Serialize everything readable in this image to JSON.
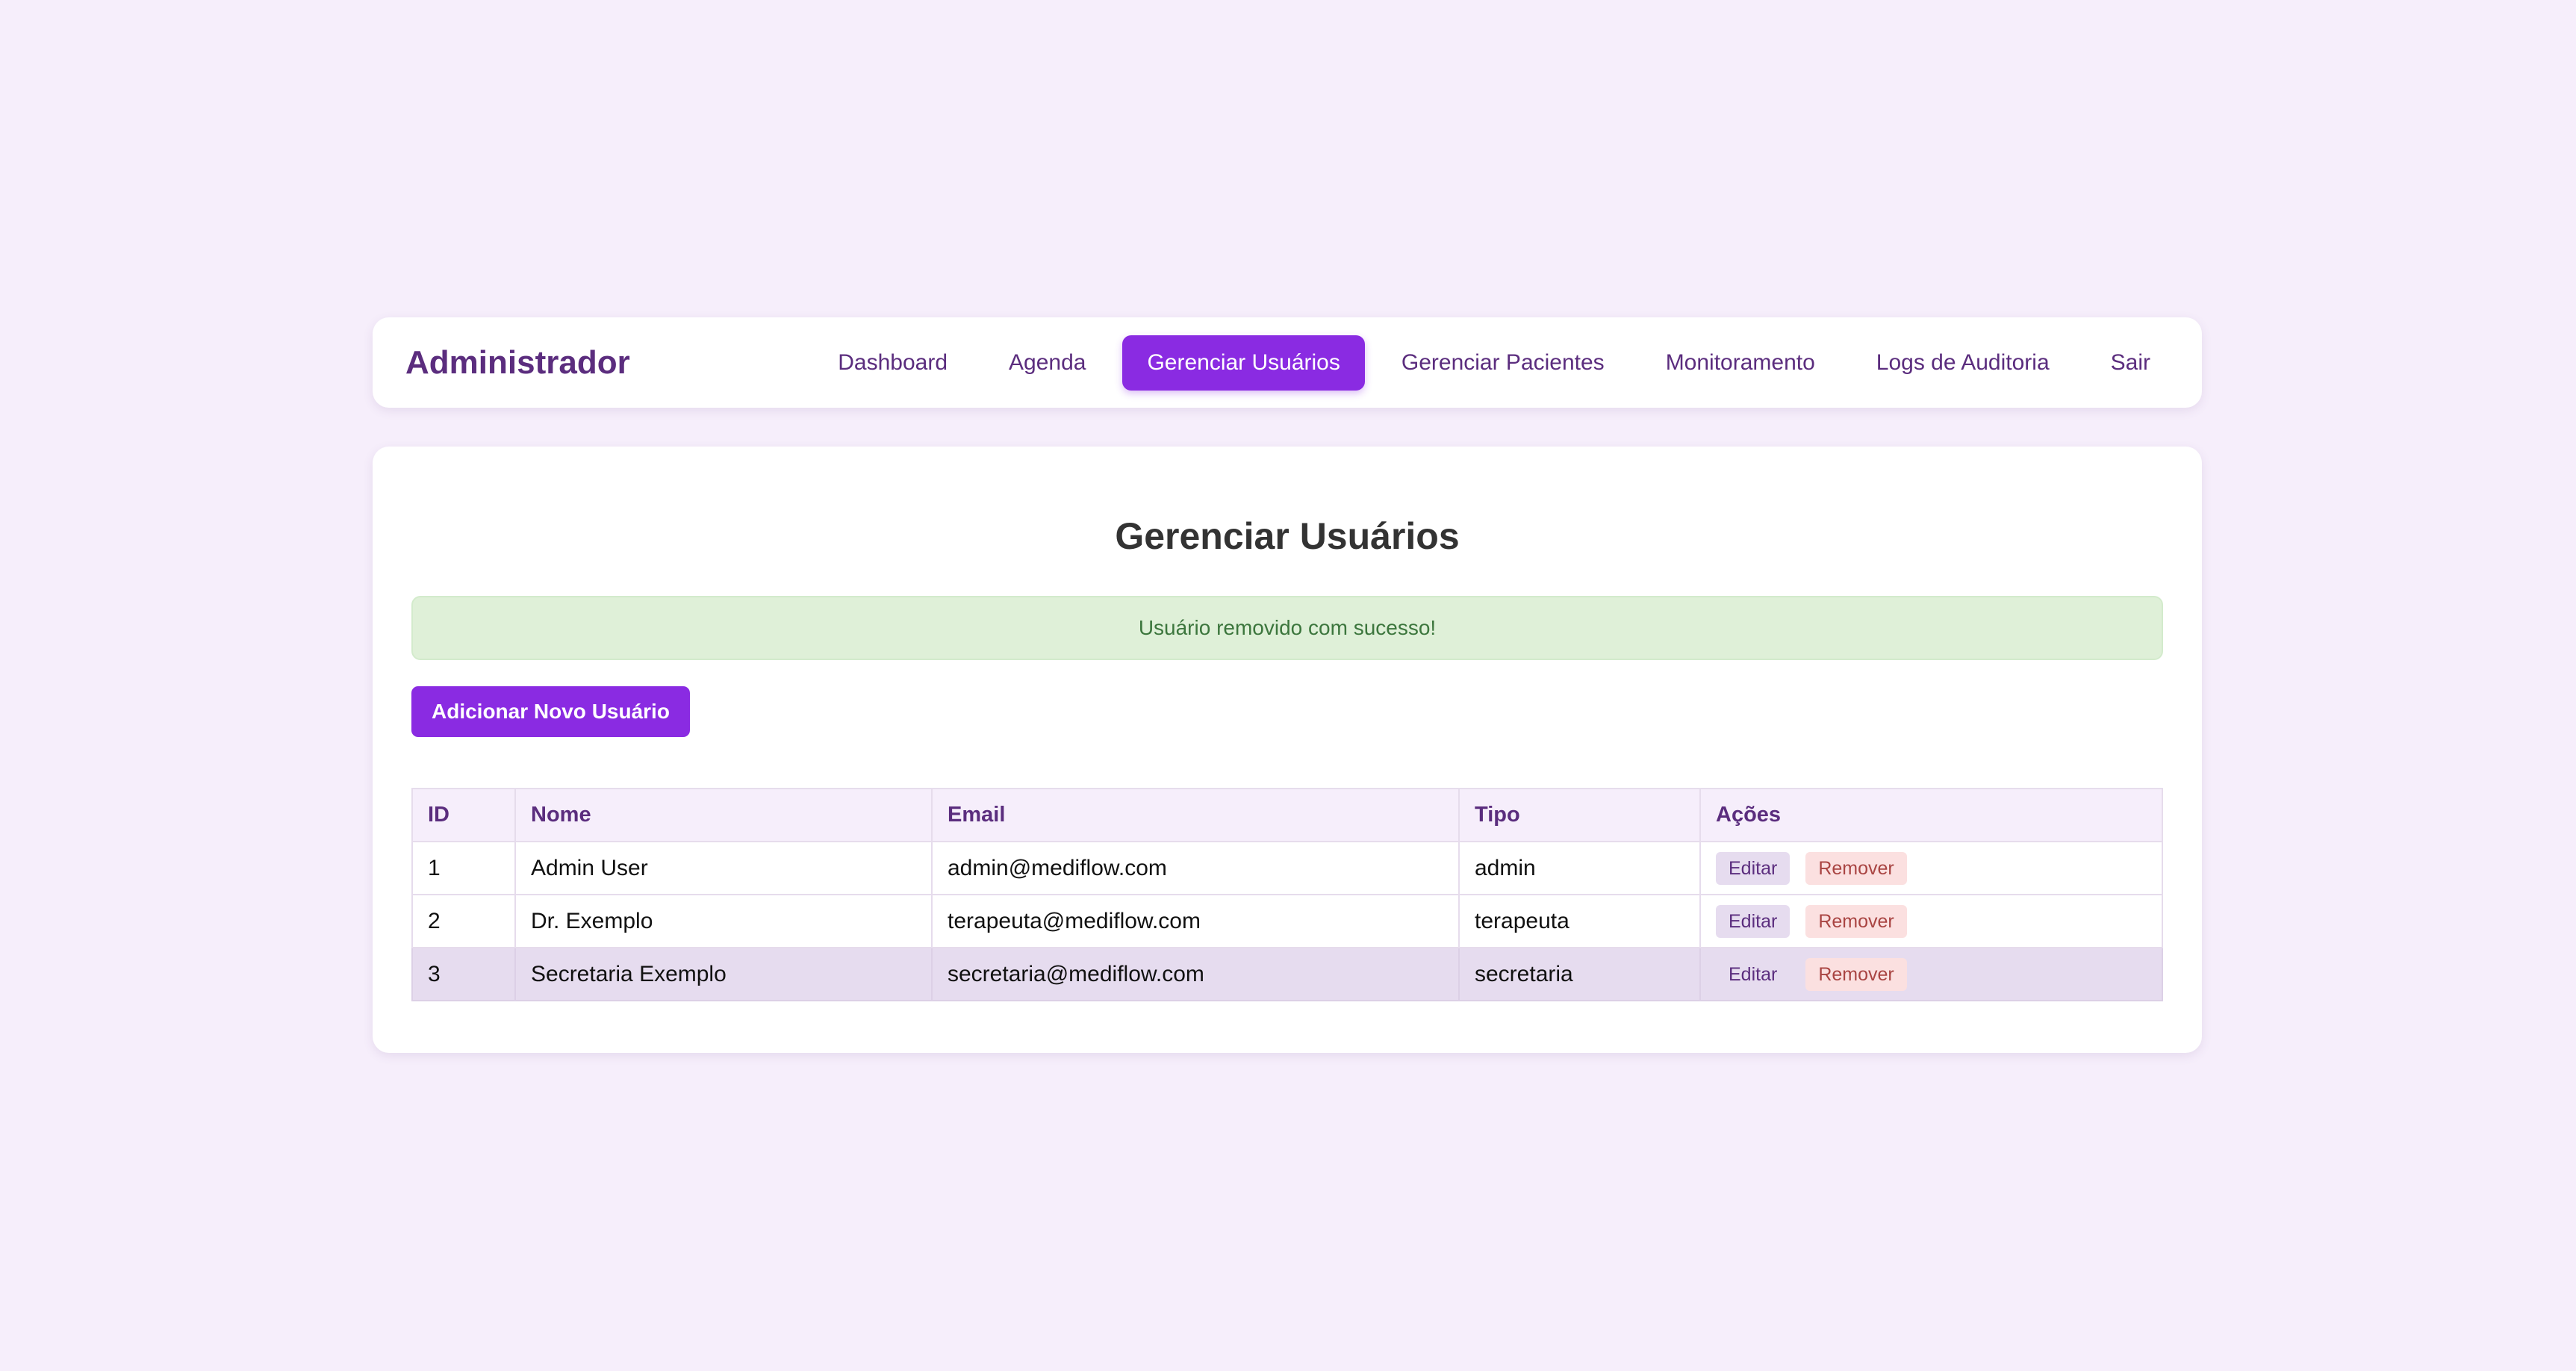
{
  "header": {
    "brand": "Administrador",
    "nav": [
      {
        "label": "Dashboard",
        "active": false
      },
      {
        "label": "Agenda",
        "active": false
      },
      {
        "label": "Gerenciar Usuários",
        "active": true
      },
      {
        "label": "Gerenciar Pacientes",
        "active": false
      },
      {
        "label": "Monitoramento",
        "active": false
      },
      {
        "label": "Logs de Auditoria",
        "active": false
      },
      {
        "label": "Sair",
        "active": false
      }
    ]
  },
  "main": {
    "title": "Gerenciar Usuários",
    "alert": "Usuário removido com sucesso!",
    "add_button": "Adicionar Novo Usuário",
    "table": {
      "columns": [
        "ID",
        "Nome",
        "Email",
        "Tipo",
        "Ações"
      ],
      "rows": [
        {
          "id": "1",
          "nome": "Admin User",
          "email": "admin@mediflow.com",
          "tipo": "admin",
          "edit": "Editar",
          "remove": "Remover"
        },
        {
          "id": "2",
          "nome": "Dr. Exemplo",
          "email": "terapeuta@mediflow.com",
          "tipo": "terapeuta",
          "edit": "Editar",
          "remove": "Remover"
        },
        {
          "id": "3",
          "nome": "Secretaria Exemplo",
          "email": "secretaria@mediflow.com",
          "tipo": "secretaria",
          "edit": "Editar",
          "remove": "Remover"
        }
      ]
    }
  },
  "colors": {
    "accent": "#8a2be2",
    "brand_text": "#5b2d7e",
    "page_bg": "#f6eefb",
    "alert_bg": "#dff0d8",
    "alert_text": "#3c763d",
    "remove_bg": "#fbe0e0",
    "remove_text": "#a94442"
  }
}
